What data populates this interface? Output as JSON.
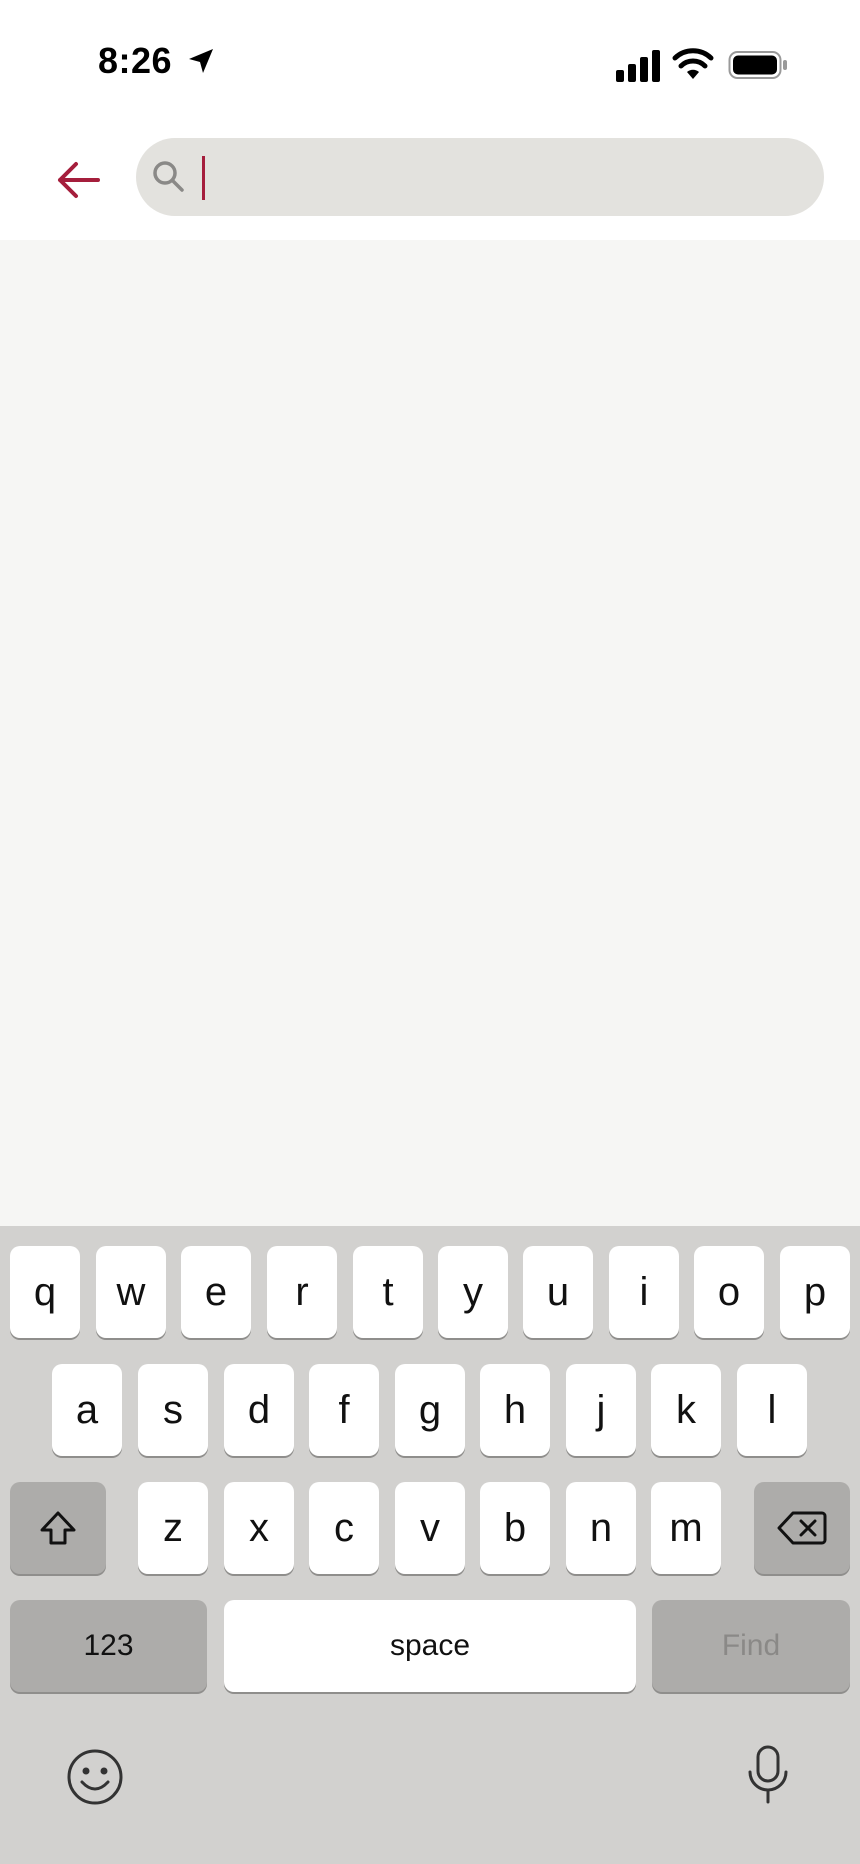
{
  "status_bar": {
    "time": "8:26",
    "icons": [
      "location-arrow-icon",
      "cellular-signal-icon",
      "wifi-icon",
      "battery-icon"
    ]
  },
  "header": {
    "back_icon": "arrow-left-icon",
    "search": {
      "placeholder": "",
      "value": "",
      "icon": "magnifier-icon"
    }
  },
  "colors": {
    "accent": "#a51e3c",
    "search_bg": "#e3e2de",
    "content_bg": "#f6f6f4",
    "keyboard_bg": "#d2d1cf",
    "key_bg": "#ffffff",
    "key_dark_bg": "#adacaa"
  },
  "keyboard": {
    "row1": [
      "q",
      "w",
      "e",
      "r",
      "t",
      "y",
      "u",
      "i",
      "o",
      "p"
    ],
    "row2": [
      "a",
      "s",
      "d",
      "f",
      "g",
      "h",
      "j",
      "k",
      "l"
    ],
    "row3": [
      "z",
      "x",
      "c",
      "v",
      "b",
      "n",
      "m"
    ],
    "numbers_label": "123",
    "space_label": "space",
    "action_label": "Find",
    "icons": [
      "shift-icon",
      "backspace-icon",
      "emoji-icon",
      "microphone-icon"
    ]
  }
}
